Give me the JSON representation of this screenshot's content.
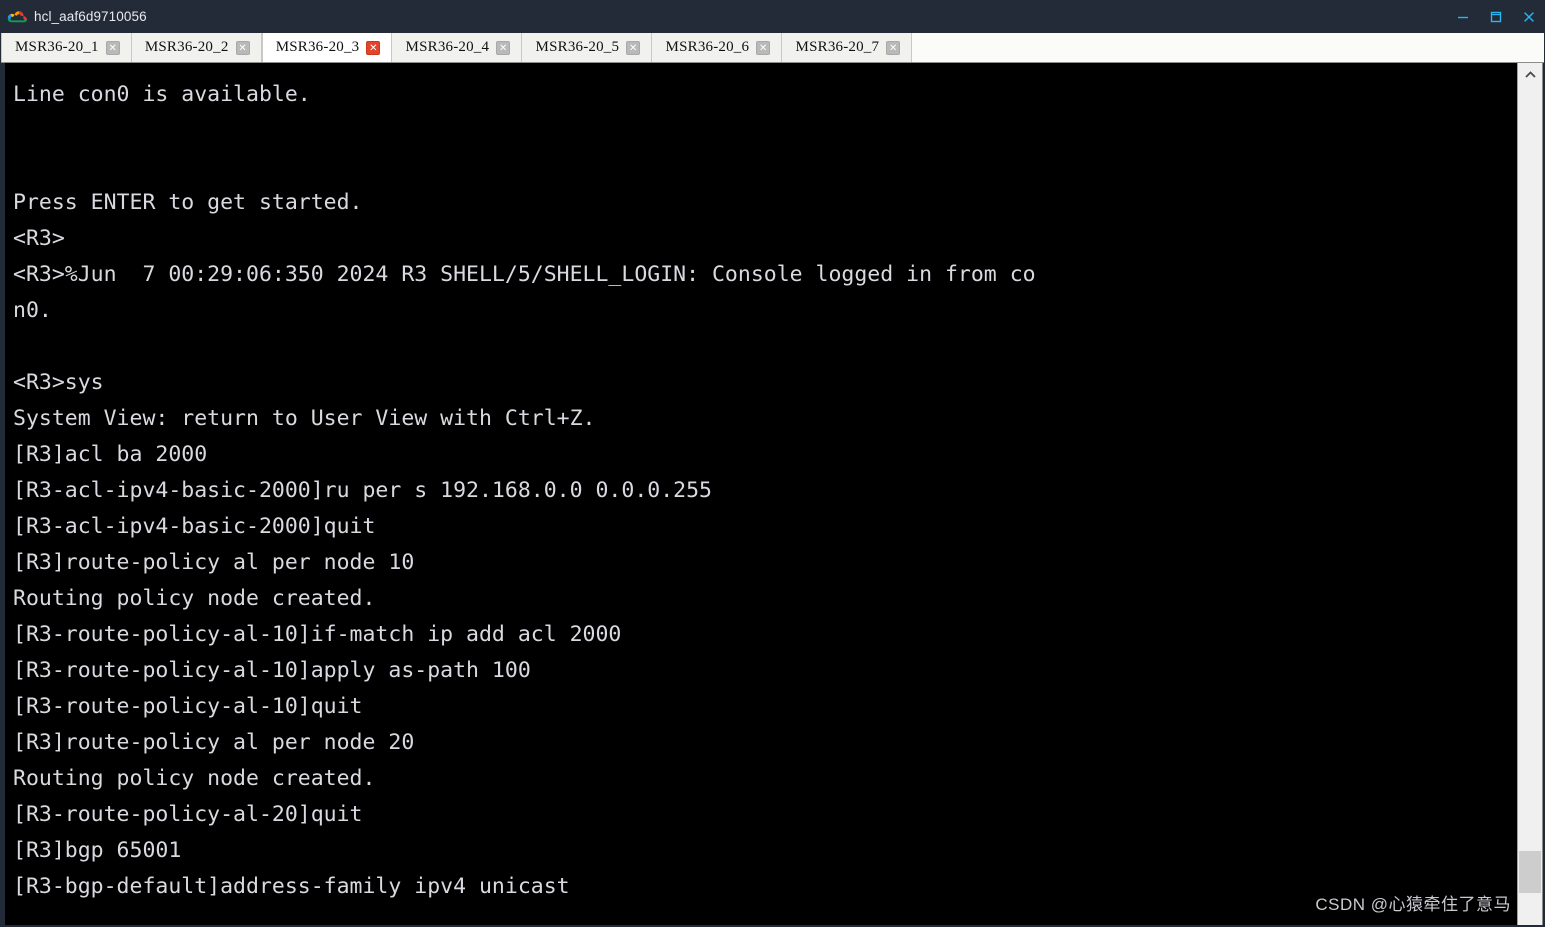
{
  "window": {
    "title": "hcl_aaf6d9710056",
    "logo_icon": "hcl-cloud-logo-icon",
    "controls": {
      "minimize_icon": "minimize-icon",
      "minimize_glyph": "—",
      "maximize_icon": "maximize-icon",
      "maximize_glyph": "❐",
      "close_icon": "close-icon",
      "close_glyph": "✕"
    },
    "accent_color": "#2bb6ef",
    "titlebar_color": "#232a38"
  },
  "tabs": {
    "active_index": 2,
    "close_glyph": "✕",
    "items": [
      {
        "label": "MSR36-20_1",
        "active": false
      },
      {
        "label": "MSR36-20_2",
        "active": false
      },
      {
        "label": "MSR36-20_3",
        "active": true
      },
      {
        "label": "MSR36-20_4",
        "active": false
      },
      {
        "label": "MSR36-20_5",
        "active": false
      },
      {
        "label": "MSR36-20_6",
        "active": false
      },
      {
        "label": "MSR36-20_7",
        "active": false
      }
    ]
  },
  "terminal": {
    "background": "#000000",
    "foreground": "#d9d9e0",
    "lines": [
      "Line con0 is available.",
      "",
      "",
      "Press ENTER to get started.",
      "<R3>",
      "<R3>%Jun  7 00:29:06:350 2024 R3 SHELL/5/SHELL_LOGIN: Console logged in from co",
      "n0.",
      "",
      "<R3>sys",
      "System View: return to User View with Ctrl+Z.",
      "[R3]acl ba 2000",
      "[R3-acl-ipv4-basic-2000]ru per s 192.168.0.0 0.0.0.255",
      "[R3-acl-ipv4-basic-2000]quit",
      "[R3]route-policy al per node 10",
      "Routing policy node created.",
      "[R3-route-policy-al-10]if-match ip add acl 2000",
      "[R3-route-policy-al-10]apply as-path 100",
      "[R3-route-policy-al-10]quit",
      "[R3]route-policy al per node 20",
      "Routing policy node created.",
      "[R3-route-policy-al-20]quit",
      "[R3]bgp 65001",
      "[R3-bgp-default]address-family ipv4 unicast"
    ]
  },
  "scrollbar": {
    "up_arrow_icon": "chevron-up-icon",
    "up_arrow_glyph": "▲",
    "thumb_position": "bottom"
  },
  "watermark": {
    "text": "CSDN @心猿牵住了意马"
  }
}
